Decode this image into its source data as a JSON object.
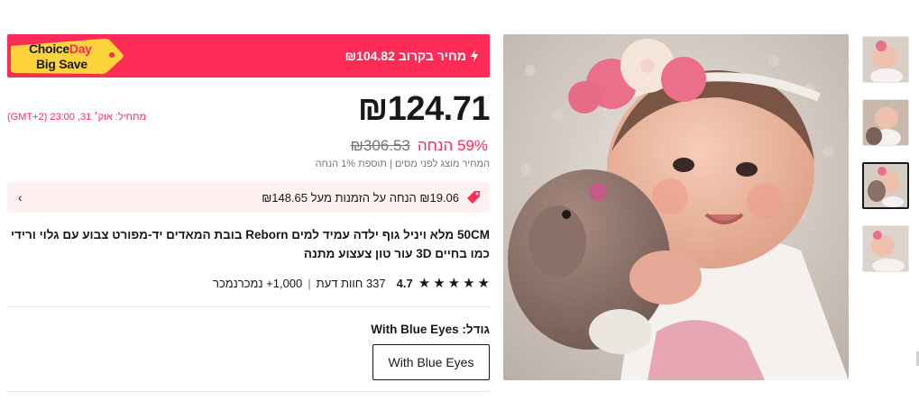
{
  "banner": {
    "tag_line1_a": "Choice",
    "tag_line1_b": "Day",
    "tag_line2": "Big Save",
    "soon_price": "מחיר בקרוב ₪104.82",
    "colors": {
      "banner_bg": "#fd2b55",
      "tag_bg": "#fcd33b"
    }
  },
  "price": {
    "current": "₪124.71",
    "start_time": "מתחיל:  אוק׳ 31, 23:00 (GMT+2)",
    "discount": "59% הנחה",
    "original": "₪306.53",
    "tax_note": "המחיר מוצג לפני מסים  |  תוספת 1% הנחה"
  },
  "coupon": {
    "text": "₪19.06 הנחה על הזמנות מעל ₪148.65",
    "icon": "coupon-tag-icon",
    "chevron": "‹"
  },
  "product": {
    "title": "50CM מלא ויניל גוף ילדה עמיד למים Reborn בובת המאדים יד-מפורט צבוע עם גלוי ורידי כמו בחיים 3D עור טון צעצוע מתנה"
  },
  "rating": {
    "value": "4.7",
    "stars": 5,
    "reviews": "337 חוות דעת",
    "sold": "1,000+ נמכרנמכר"
  },
  "size": {
    "label": "גודל: With Blue Eyes",
    "options": [
      "With Blue Eyes"
    ],
    "selected": "With Blue Eyes"
  },
  "gallery": {
    "thumb_count": 4,
    "active_thumb": 3
  }
}
